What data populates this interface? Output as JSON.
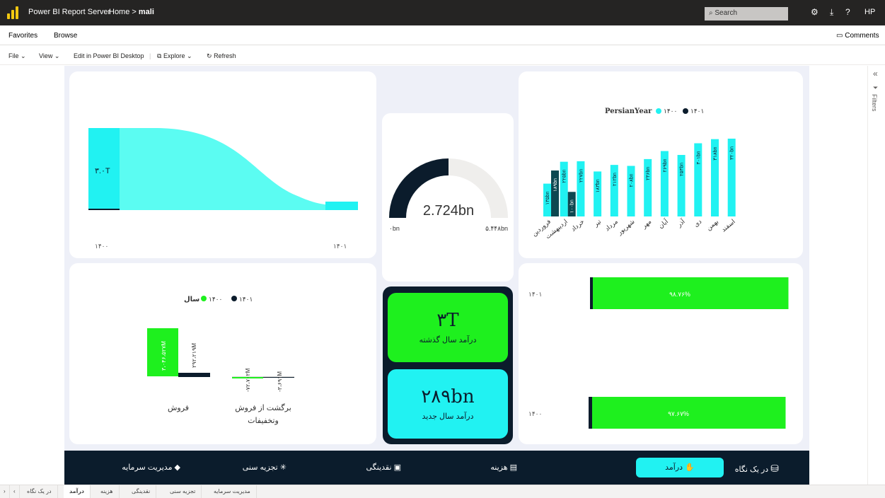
{
  "app": {
    "title": "Power BI Report Server",
    "breadcrumb_home": "Home",
    "breadcrumb_sep": ">",
    "breadcrumb_current": "mali",
    "search_placeholder": "Search",
    "user": "HP"
  },
  "menu": {
    "favorites": "Favorites",
    "browse": "Browse",
    "comments": "Comments"
  },
  "toolbar": {
    "file": "File ⌄",
    "view": "View ⌄",
    "edit": "Edit in Power BI Desktop",
    "explore": "Explore ⌄",
    "refresh": "Refresh"
  },
  "funnel": {
    "value_label": "۳.۰T",
    "left_year": "۱۴۰۰",
    "right_year": "۱۴۰۱"
  },
  "gauge": {
    "value": "2.724bn",
    "min": "۰bn",
    "max": "۵.۴۴۸bn",
    "fraction": 0.5
  },
  "monthly": {
    "legend_title": "PersianYear",
    "legend_1400": "۱۴۰۰",
    "legend_1401": "۱۴۰۱",
    "colors": {
      "y1400": "#21f2f2",
      "y1401": "#0d4851"
    },
    "months": [
      "فروردین",
      "اردیبهشت",
      "خرداد",
      "تیر",
      "مرداد",
      "شهریور",
      "مهر",
      "آبان",
      "آذر",
      "دی",
      "بهمن",
      "اسفند"
    ],
    "v1400": [
      135,
      225,
      227,
      185,
      212,
      208,
      236,
      269,
      253,
      301,
      318,
      320
    ],
    "l1400": [
      "۱۳۵bn",
      "۲۲۵bn",
      "۲۲۷bn",
      "۱۸۳bn",
      "۲۱۲bn",
      "۲۰۸bn",
      "۲۳۶bn",
      "۲۶۹bn",
      "۲۵۳bn",
      "۳۰۱bn",
      "۳۱۸bn",
      "۳۲۰bn"
    ],
    "v1401": [
      189,
      101,
      null,
      null,
      null,
      null,
      null,
      null,
      null,
      null,
      null,
      null
    ],
    "l1401": [
      "۱۸۹bn",
      "۱۰۰bn",
      "",
      "",
      "",
      "",
      "",
      "",
      "",
      "",
      "",
      ""
    ]
  },
  "sales": {
    "legend_title": "سال",
    "legend_1400": "۱۴۰۰",
    "legend_1401": "۱۴۰۱",
    "cat1": "فروش",
    "cat2_line1": "برگشت از فروش",
    "cat2_line2": "وتخفیفات",
    "bar1_1400": "۳،۰۴۶،۵۲۷M",
    "bar1_1401": "۲۹۲،۲۱۹M",
    "bar2_1400": "-۷۲،۷۰۲M",
    "bar2_1401": "-۳،۶۹۱M"
  },
  "kpi1": {
    "value": "۳T",
    "label": "درآمد سال گذشته",
    "color": "#1ef01e"
  },
  "kpi2": {
    "value": "۲۸۹bn",
    "label": "درآمد سال جدید",
    "color": "#21f2f2"
  },
  "progress": [
    {
      "year": "۱۴۰۱",
      "label": "۹۸.۷۶%",
      "fraction": 0.9876
    },
    {
      "year": "۱۴۰۰",
      "label": "۹۷.۶۷%",
      "fraction": 0.9767
    }
  ],
  "nav": {
    "overview": "در یک نگاه",
    "income": "درآمد",
    "cost": "هزینه",
    "liquidity": "نقدینگی",
    "age": "تجزیه سنی",
    "capital": "مدیریت سرمایه"
  },
  "tabs": [
    "در یک نگاه",
    "درآمد",
    "هزینه",
    "نقدینگی",
    "تجزیه سنی",
    "مدیریت سرمایه"
  ],
  "filters_label": "Filters"
}
